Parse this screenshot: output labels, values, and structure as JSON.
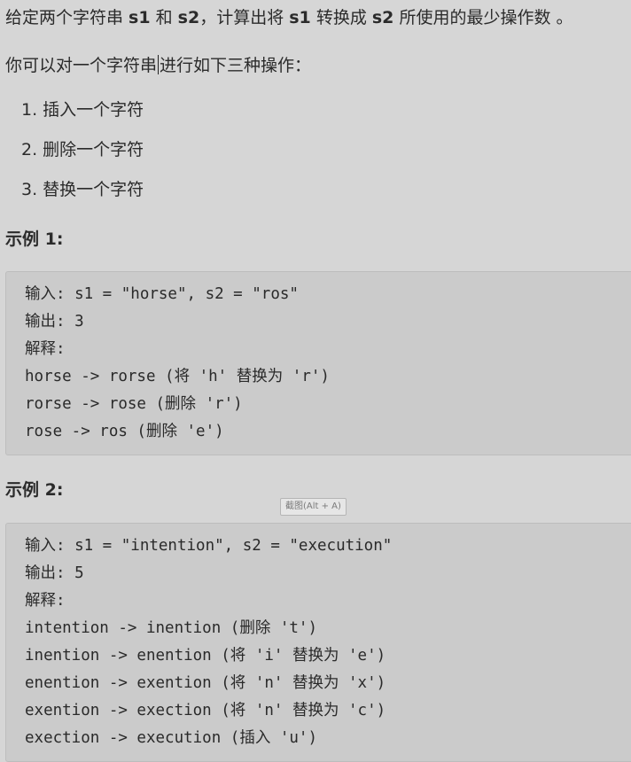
{
  "intro": {
    "seg1": "给定两个字符串 ",
    "b1": "s1",
    "seg2": " 和 ",
    "b2": "s2",
    "seg3": "，计算出将 ",
    "b3": "s1",
    "seg4": " 转换成 ",
    "b4": "s2",
    "seg5": " 所使用的最少操作数 。"
  },
  "ops_intro": {
    "before_caret": "你可以对一个字符串",
    "after_caret": "进行如下三种操作："
  },
  "operations": [
    "1. 插入一个字符",
    "2. 删除一个字符",
    "3. 替换一个字符"
  ],
  "example1": {
    "heading": "示例 1:",
    "lines": [
      "输入: s1 = \"horse\", s2 = \"ros\"",
      "输出: 3",
      "解释:",
      "horse -> rorse (将 'h' 替换为 'r')",
      "rorse -> rose (删除 'r')",
      "rose -> ros (删除 'e')"
    ]
  },
  "example2": {
    "heading": "示例 2:",
    "lines": [
      "输入: s1 = \"intention\", s2 = \"execution\"",
      "输出: 5",
      "解释:",
      "intention -> inention (删除 't')",
      "inention -> enention (将 'i' 替换为 'e')",
      "enention -> exention (将 'n' 替换为 'x')",
      "exention -> exection (将 'n' 替换为 'c')",
      "exection -> execution (插入 'u')"
    ]
  },
  "tooltip": "截图(Alt + A)"
}
